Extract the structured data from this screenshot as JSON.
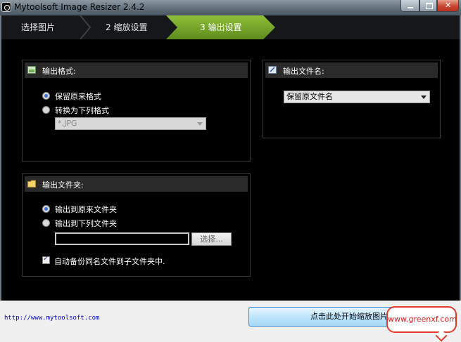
{
  "window": {
    "title": "Mytoolsoft Image Resizer 2.4.2"
  },
  "steps": [
    {
      "label": "选择图片"
    },
    {
      "label": "2  缩放设置"
    },
    {
      "label": "3  输出设置"
    }
  ],
  "output_format": {
    "title": "输出格式:",
    "options": [
      "保留原来格式",
      "转换为下列格式"
    ],
    "selected": "保留原来格式",
    "format_value": "*.JPG"
  },
  "output_filename": {
    "title": "输出文件名:",
    "value": "保留原文件名"
  },
  "output_folder": {
    "title": "输出文件夹:",
    "options": [
      "输出到原来文件夹",
      "输出到下列文件夹"
    ],
    "selected": "输出到原来文件夹",
    "path_value": "",
    "browse_label": "选择...",
    "backup_label": "自动备份同名文件到子文件夹中.",
    "backup_checked": true
  },
  "footer": {
    "link": "http://www.mytoolsoft.com",
    "start_label": "点击此处开始缩放图片"
  },
  "watermark": "www.greenxf.com",
  "colors": {
    "accent_step": "#7aac2c",
    "title_bar": "#6b7a86",
    "link": "#0000c8",
    "watermark": "#d81e1e"
  }
}
